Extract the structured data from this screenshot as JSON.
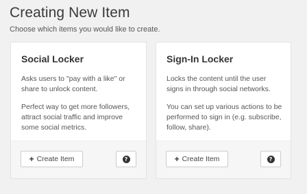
{
  "header": {
    "title": "Creating New Item",
    "subtitle": "Choose which items you would like to create."
  },
  "cards": [
    {
      "title": "Social Locker",
      "paragraphs": [
        "Asks users to \"pay with a like\" or share to unlock content.",
        "Perfect way to get more followers, attract social traffic and improve some social metrics."
      ],
      "create_label": "Create Item",
      "create_icon": "plus-icon",
      "help_icon": "question-circle-icon"
    },
    {
      "title": "Sign-In Locker",
      "paragraphs": [
        "Locks the content until the user signs in through social networks.",
        "You can set up various actions to be performed to sign in (e.g. subscribe, follow, share)."
      ],
      "create_label": "Create Item",
      "create_icon": "plus-icon",
      "help_icon": "question-circle-icon"
    }
  ],
  "glyphs": {
    "plus": "+",
    "question": "?"
  },
  "colors": {
    "background": "#f1f1f1",
    "card": "#ffffff",
    "footer": "#f6f6f6",
    "button_border": "#cccccc",
    "text": "#444444"
  }
}
